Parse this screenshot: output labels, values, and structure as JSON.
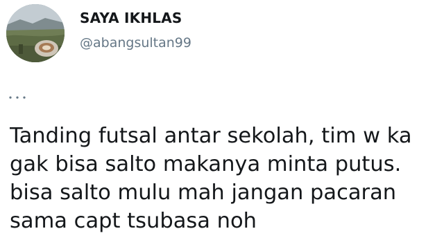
{
  "user": {
    "display_name": "SAYA IKHLAS",
    "handle": "@abangsultan99"
  },
  "icons": {
    "avatar": "profile-photo-landscape-coffee",
    "more": "ellipsis-dots-icon"
  },
  "tweet": {
    "lines": [
      "Tanding futsal antar sekolah, tim w ka",
      "gak bisa salto makanya minta putus.",
      "bisa salto mulu mah jangan pacaran",
      "sama capt tsubasa noh"
    ]
  },
  "colors": {
    "text": "#14171a",
    "secondary": "#657786"
  }
}
